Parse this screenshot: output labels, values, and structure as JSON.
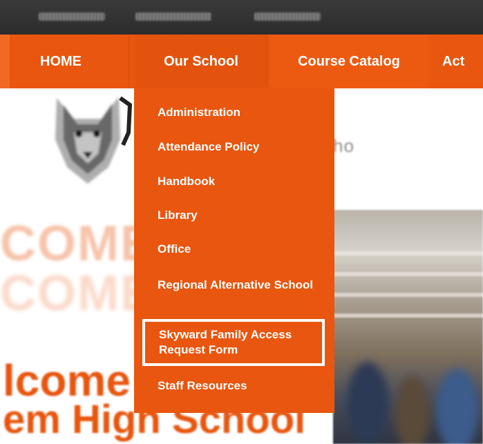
{
  "nav": {
    "items": [
      {
        "label": "HOME"
      },
      {
        "label": "Our School"
      },
      {
        "label": "Course Catalog"
      },
      {
        "label": "Act"
      }
    ]
  },
  "dropdown": {
    "items": [
      {
        "label": "Administration"
      },
      {
        "label": "Attendance Policy"
      },
      {
        "label": "Handbook"
      },
      {
        "label": "Library"
      },
      {
        "label": "Office"
      },
      {
        "label": "Regional Alternative School"
      },
      {
        "label": "Skyward Family Access Request Form"
      },
      {
        "label": "Staff Resources"
      }
    ],
    "highlighted_index": 6
  },
  "colors": {
    "brand_orange": "#e8560f",
    "topbar": "#2f2f2f",
    "text_on_brand": "#ffffff"
  },
  "icons": {
    "mascot": "wolf-mascot-logo"
  }
}
